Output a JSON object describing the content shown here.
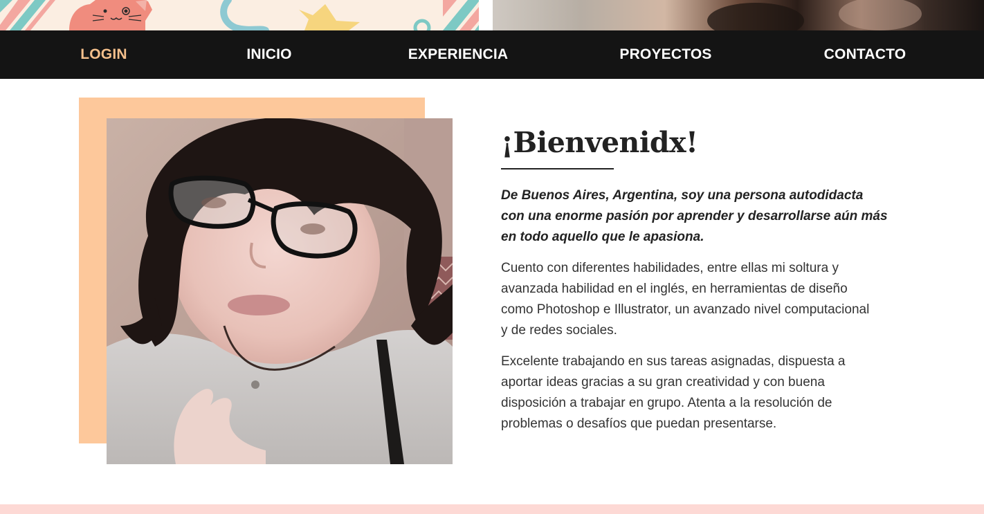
{
  "colors": {
    "accent": "#f5c08c",
    "nav_bg": "#141414",
    "nav_text": "#ffffff",
    "photo_backdrop": "#fdc89b",
    "footer_strip": "#fdd9d5",
    "banner_bg": "#fbeee2"
  },
  "nav": {
    "items": [
      {
        "label": "LOGIN",
        "active": true
      },
      {
        "label": "INICIO",
        "active": false
      },
      {
        "label": "EXPERIENCIA",
        "active": false
      },
      {
        "label": "PROYECTOS",
        "active": false
      },
      {
        "label": "CONTACTO",
        "active": false
      }
    ]
  },
  "banner": {
    "left_icons": [
      "cat-illustration-icon",
      "star-illustration-icon",
      "ring-illustration-icon"
    ]
  },
  "hero": {
    "title": "¡Bienvenidx!",
    "lead": "De Buenos Aires, Argentina, soy una persona autodidacta con una enorme pasión por aprender y desarrollarse aún más en todo aquello que le apasiona.",
    "paragraph_1": "Cuento con diferentes habilidades, entre ellas mi soltura y avanzada habilidad en el inglés, en herramientas de diseño como Photoshop e Illustrator, un avanzado nivel computacional y de redes sociales.",
    "paragraph_2": "Excelente trabajando en sus tareas asignadas, dispuesta a aportar ideas gracias a su gran creatividad y con buena disposición a trabajar en grupo. Atenta a la resolución de problemas o desafíos que puedan presentarse."
  }
}
